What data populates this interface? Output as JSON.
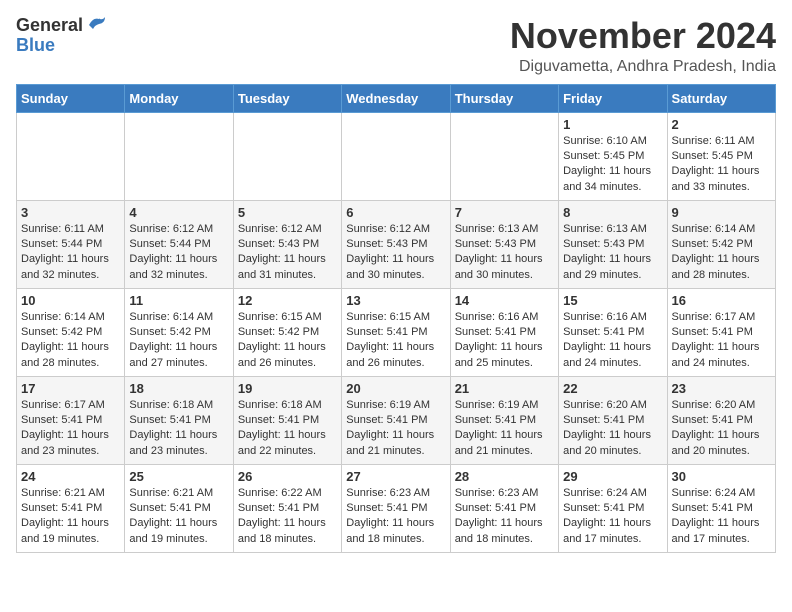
{
  "header": {
    "logo_general": "General",
    "logo_blue": "Blue",
    "month_title": "November 2024",
    "location": "Diguvametta, Andhra Pradesh, India"
  },
  "days_of_week": [
    "Sunday",
    "Monday",
    "Tuesday",
    "Wednesday",
    "Thursday",
    "Friday",
    "Saturday"
  ],
  "weeks": [
    [
      {
        "day": "",
        "info": ""
      },
      {
        "day": "",
        "info": ""
      },
      {
        "day": "",
        "info": ""
      },
      {
        "day": "",
        "info": ""
      },
      {
        "day": "",
        "info": ""
      },
      {
        "day": "1",
        "info": "Sunrise: 6:10 AM\nSunset: 5:45 PM\nDaylight: 11 hours\nand 34 minutes."
      },
      {
        "day": "2",
        "info": "Sunrise: 6:11 AM\nSunset: 5:45 PM\nDaylight: 11 hours\nand 33 minutes."
      }
    ],
    [
      {
        "day": "3",
        "info": "Sunrise: 6:11 AM\nSunset: 5:44 PM\nDaylight: 11 hours\nand 32 minutes."
      },
      {
        "day": "4",
        "info": "Sunrise: 6:12 AM\nSunset: 5:44 PM\nDaylight: 11 hours\nand 32 minutes."
      },
      {
        "day": "5",
        "info": "Sunrise: 6:12 AM\nSunset: 5:43 PM\nDaylight: 11 hours\nand 31 minutes."
      },
      {
        "day": "6",
        "info": "Sunrise: 6:12 AM\nSunset: 5:43 PM\nDaylight: 11 hours\nand 30 minutes."
      },
      {
        "day": "7",
        "info": "Sunrise: 6:13 AM\nSunset: 5:43 PM\nDaylight: 11 hours\nand 30 minutes."
      },
      {
        "day": "8",
        "info": "Sunrise: 6:13 AM\nSunset: 5:43 PM\nDaylight: 11 hours\nand 29 minutes."
      },
      {
        "day": "9",
        "info": "Sunrise: 6:14 AM\nSunset: 5:42 PM\nDaylight: 11 hours\nand 28 minutes."
      }
    ],
    [
      {
        "day": "10",
        "info": "Sunrise: 6:14 AM\nSunset: 5:42 PM\nDaylight: 11 hours\nand 28 minutes."
      },
      {
        "day": "11",
        "info": "Sunrise: 6:14 AM\nSunset: 5:42 PM\nDaylight: 11 hours\nand 27 minutes."
      },
      {
        "day": "12",
        "info": "Sunrise: 6:15 AM\nSunset: 5:42 PM\nDaylight: 11 hours\nand 26 minutes."
      },
      {
        "day": "13",
        "info": "Sunrise: 6:15 AM\nSunset: 5:41 PM\nDaylight: 11 hours\nand 26 minutes."
      },
      {
        "day": "14",
        "info": "Sunrise: 6:16 AM\nSunset: 5:41 PM\nDaylight: 11 hours\nand 25 minutes."
      },
      {
        "day": "15",
        "info": "Sunrise: 6:16 AM\nSunset: 5:41 PM\nDaylight: 11 hours\nand 24 minutes."
      },
      {
        "day": "16",
        "info": "Sunrise: 6:17 AM\nSunset: 5:41 PM\nDaylight: 11 hours\nand 24 minutes."
      }
    ],
    [
      {
        "day": "17",
        "info": "Sunrise: 6:17 AM\nSunset: 5:41 PM\nDaylight: 11 hours\nand 23 minutes."
      },
      {
        "day": "18",
        "info": "Sunrise: 6:18 AM\nSunset: 5:41 PM\nDaylight: 11 hours\nand 23 minutes."
      },
      {
        "day": "19",
        "info": "Sunrise: 6:18 AM\nSunset: 5:41 PM\nDaylight: 11 hours\nand 22 minutes."
      },
      {
        "day": "20",
        "info": "Sunrise: 6:19 AM\nSunset: 5:41 PM\nDaylight: 11 hours\nand 21 minutes."
      },
      {
        "day": "21",
        "info": "Sunrise: 6:19 AM\nSunset: 5:41 PM\nDaylight: 11 hours\nand 21 minutes."
      },
      {
        "day": "22",
        "info": "Sunrise: 6:20 AM\nSunset: 5:41 PM\nDaylight: 11 hours\nand 20 minutes."
      },
      {
        "day": "23",
        "info": "Sunrise: 6:20 AM\nSunset: 5:41 PM\nDaylight: 11 hours\nand 20 minutes."
      }
    ],
    [
      {
        "day": "24",
        "info": "Sunrise: 6:21 AM\nSunset: 5:41 PM\nDaylight: 11 hours\nand 19 minutes."
      },
      {
        "day": "25",
        "info": "Sunrise: 6:21 AM\nSunset: 5:41 PM\nDaylight: 11 hours\nand 19 minutes."
      },
      {
        "day": "26",
        "info": "Sunrise: 6:22 AM\nSunset: 5:41 PM\nDaylight: 11 hours\nand 18 minutes."
      },
      {
        "day": "27",
        "info": "Sunrise: 6:23 AM\nSunset: 5:41 PM\nDaylight: 11 hours\nand 18 minutes."
      },
      {
        "day": "28",
        "info": "Sunrise: 6:23 AM\nSunset: 5:41 PM\nDaylight: 11 hours\nand 18 minutes."
      },
      {
        "day": "29",
        "info": "Sunrise: 6:24 AM\nSunset: 5:41 PM\nDaylight: 11 hours\nand 17 minutes."
      },
      {
        "day": "30",
        "info": "Sunrise: 6:24 AM\nSunset: 5:41 PM\nDaylight: 11 hours\nand 17 minutes."
      }
    ]
  ]
}
